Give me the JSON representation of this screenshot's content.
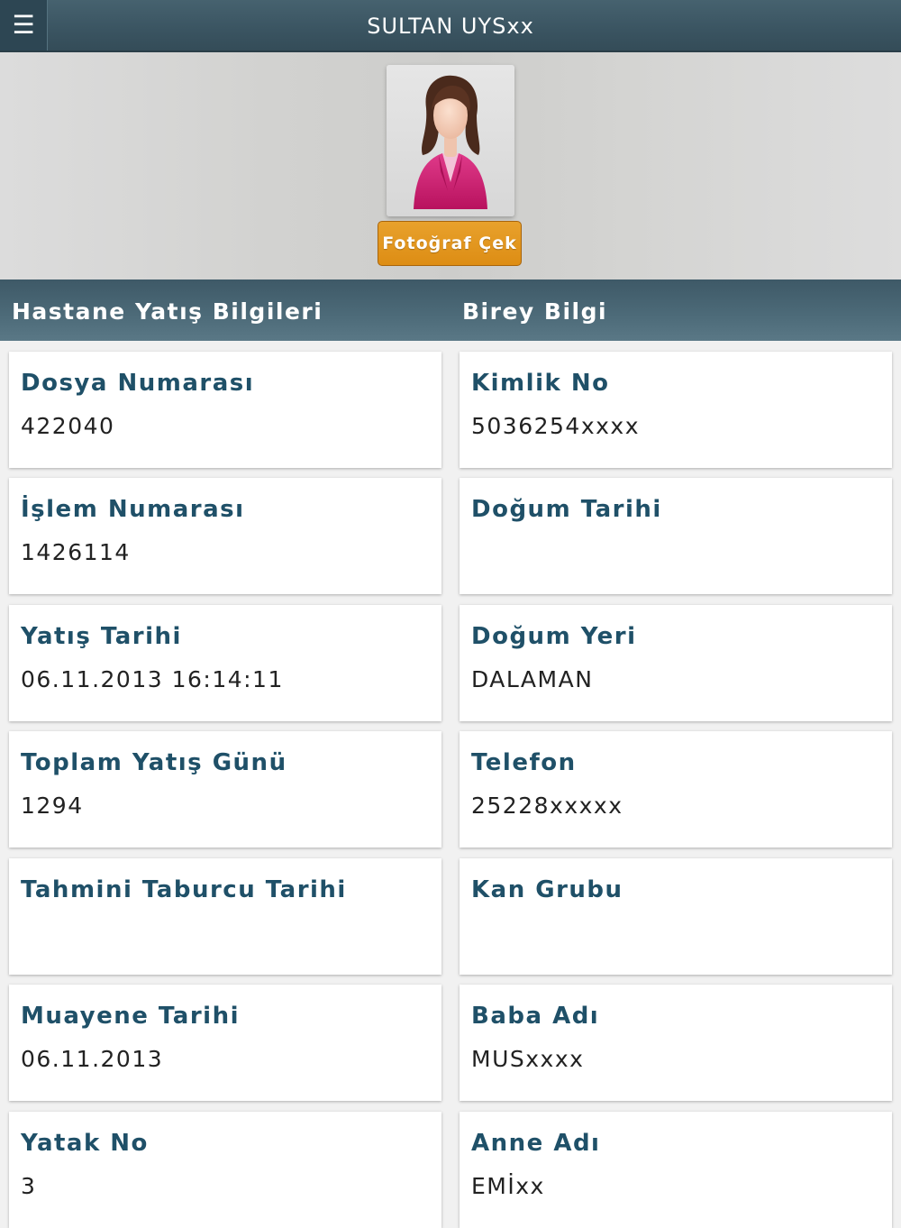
{
  "topbar": {
    "menu_icon": "☰",
    "title": "SULTAN UYSxx"
  },
  "profile": {
    "avatar": "female-avatar",
    "photo_button": "Fotoğraf Çek"
  },
  "sections": {
    "left": "Hastane Yatış Bilgileri",
    "right": "Birey Bilgi"
  },
  "left_cards": [
    {
      "label": "Dosya Numarası",
      "value": "422040"
    },
    {
      "label": "İşlem Numarası",
      "value": "1426114"
    },
    {
      "label": "Yatış Tarihi",
      "value": "06.11.2013 16:14:11"
    },
    {
      "label": "Toplam Yatış Günü",
      "value": "1294"
    },
    {
      "label": "Tahmini Taburcu Tarihi",
      "value": ""
    },
    {
      "label": "Muayene Tarihi",
      "value": "06.11.2013"
    },
    {
      "label": "Yatak No",
      "value": "3"
    }
  ],
  "right_cards": [
    {
      "label": "Kimlik No",
      "value": "5036254xxxx"
    },
    {
      "label": "Doğum Tarihi",
      "value": ""
    },
    {
      "label": "Doğum Yeri",
      "value": "DALAMAN"
    },
    {
      "label": "Telefon",
      "value": "25228xxxxx"
    },
    {
      "label": "Kan Grubu",
      "value": ""
    },
    {
      "label": "Baba Adı",
      "value": "MUSxxxx"
    },
    {
      "label": "Anne Adı",
      "value": "EMİxx"
    }
  ]
}
